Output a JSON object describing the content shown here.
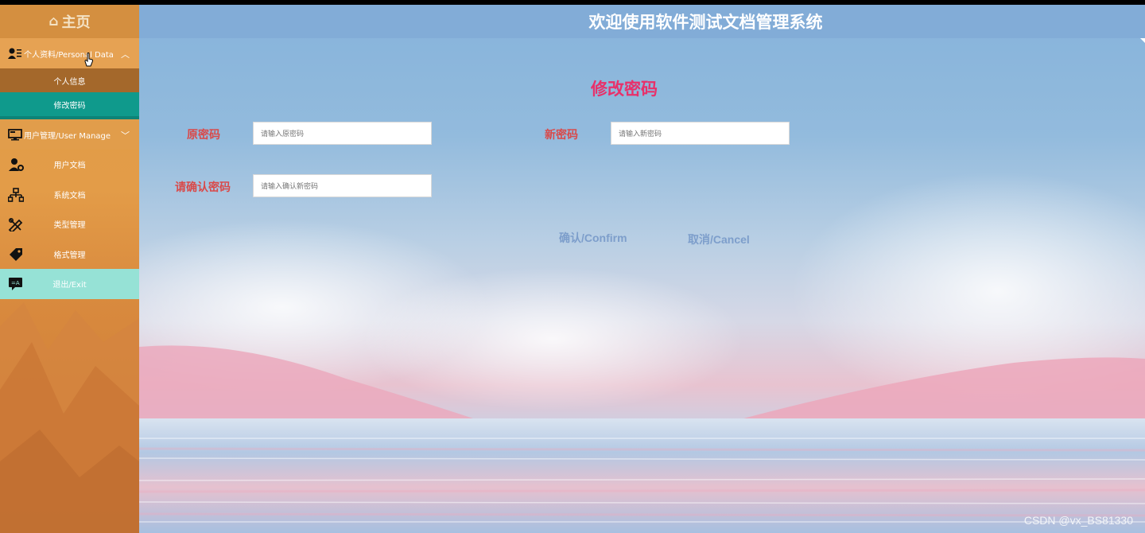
{
  "sidebar": {
    "home_label": "主页",
    "groups": [
      {
        "label": "个人资料/Personal Data",
        "items": [
          "个人信息",
          "修改密码"
        ]
      },
      {
        "label": "用户管理/User Manage",
        "items": [
          "用户文档",
          "系统文档",
          "类型管理",
          "格式管理",
          "退出/Exit"
        ]
      }
    ]
  },
  "header": {
    "title": "欢迎使用软件测试文档管理系统"
  },
  "form": {
    "title": "修改密码",
    "old_password": {
      "label": "原密码",
      "placeholder": "请输入原密码"
    },
    "new_password": {
      "label": "新密码",
      "placeholder": "请输入新密码"
    },
    "confirm_password": {
      "label": "请确认密码",
      "placeholder": "请输入确认新密码"
    },
    "confirm_button": "确认/Confirm",
    "cancel_button": "取消/Cancel"
  },
  "watermark": "CSDN @vx_BS81330",
  "colors": {
    "sidebar": "#e09a45",
    "active_item": "#0f9a8c",
    "exit_item": "#96e2d6",
    "header": "#82acd7",
    "form_title": "#e8306a",
    "label": "#d94a4a",
    "button_text": "#7d9ecb"
  }
}
